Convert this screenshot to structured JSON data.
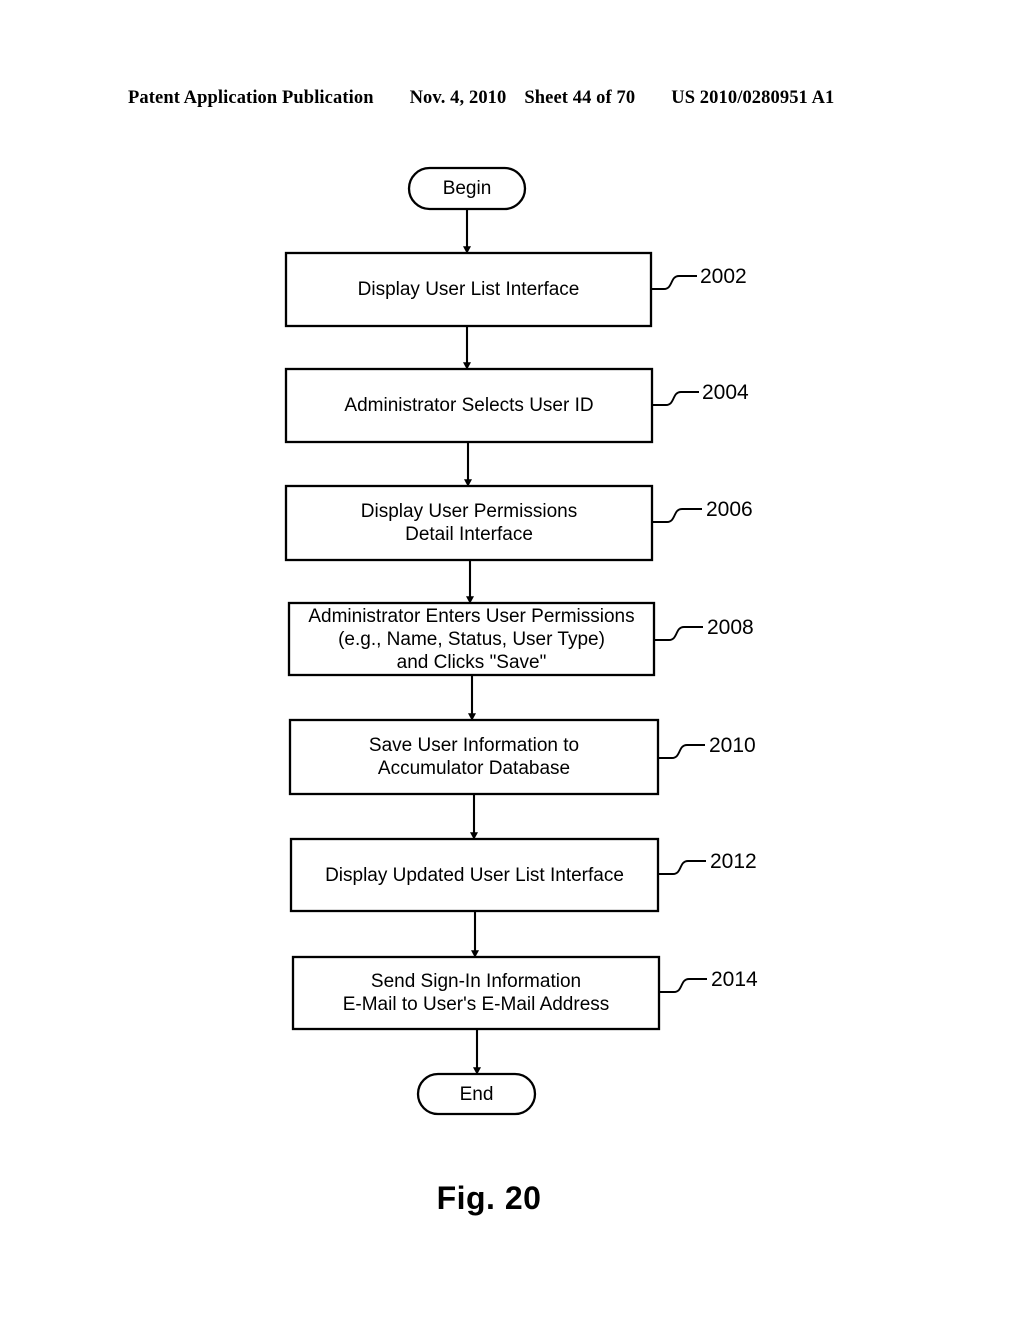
{
  "header": {
    "publication": "Patent Application Publication",
    "date": "Nov. 4, 2010",
    "sheet": "Sheet 44 of 70",
    "patent_number": "US 2010/0280951 A1"
  },
  "figure": {
    "caption": "Fig. 20",
    "type": "flowchart",
    "line_color": "#000000",
    "background": "#ffffff"
  },
  "flowchart": {
    "start_label": "Begin",
    "end_label": "End",
    "steps": [
      {
        "ref": "2002",
        "lines": [
          "Display User List Interface"
        ]
      },
      {
        "ref": "2004",
        "lines": [
          "Administrator Selects User ID"
        ]
      },
      {
        "ref": "2006",
        "lines": [
          "Display User Permissions",
          "Detail Interface"
        ]
      },
      {
        "ref": "2008",
        "lines": [
          "Administrator Enters User Permissions",
          "(e.g., Name, Status, User Type)",
          "and Clicks \"Save\""
        ]
      },
      {
        "ref": "2010",
        "lines": [
          "Save User Information to",
          "Accumulator Database"
        ]
      },
      {
        "ref": "2012",
        "lines": [
          "Display Updated User List Interface"
        ]
      },
      {
        "ref": "2014",
        "lines": [
          "Send Sign-In Information",
          "E-Mail to User's E-Mail Address"
        ]
      }
    ]
  }
}
